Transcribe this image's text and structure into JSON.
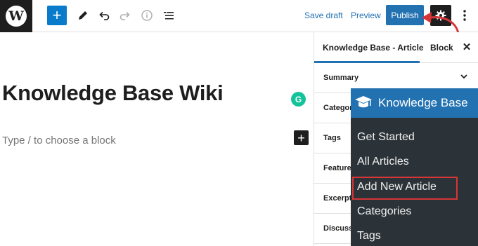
{
  "toolbar": {
    "logo_letter": "W",
    "save_draft_label": "Save draft",
    "preview_label": "Preview",
    "publish_label": "Publish",
    "add_block_glyph": "+",
    "icons": [
      "wordpress-logo-icon",
      "add-block-icon",
      "pen-icon",
      "undo-icon",
      "redo-icon",
      "info-icon",
      "list-view-icon",
      "gear-icon",
      "more-options-icon"
    ]
  },
  "editor": {
    "title": "Knowledge Base Wiki",
    "block_placeholder": "Type / to choose a block",
    "grammarly_letter": "G",
    "inserter_glyph": "+"
  },
  "sidebar": {
    "tab_article": "Knowledge Base - Article",
    "tab_block": "Block",
    "close_glyph": "✕",
    "panels": [
      {
        "label": "Summary"
      },
      {
        "label": "Categories"
      },
      {
        "label": "Tags"
      },
      {
        "label": "Featured image"
      },
      {
        "label": "Excerpt"
      },
      {
        "label": "Discussion"
      }
    ]
  },
  "kb_menu": {
    "title": "Knowledge Base",
    "items": [
      "Get Started",
      "All Articles",
      "Add New Article",
      "Categories",
      "Tags"
    ],
    "highlighted_item": "Add New Article"
  },
  "colors": {
    "accent": "#2271b1",
    "add_button": "#0a7aca",
    "admin_menu_bg": "#2c3338",
    "highlight_red": "#d63638",
    "grammarly": "#15c39a"
  }
}
